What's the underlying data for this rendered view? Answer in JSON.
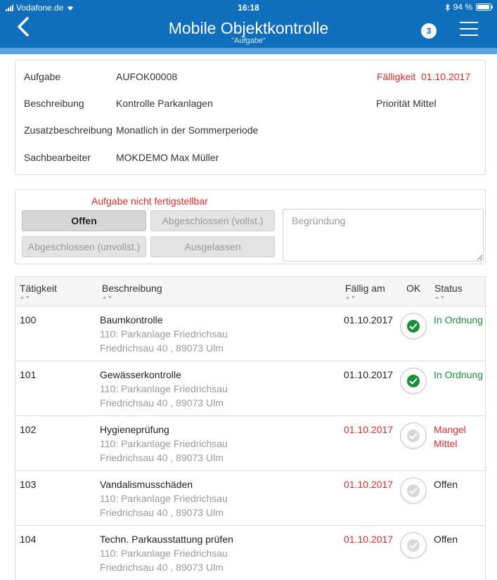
{
  "statusbar": {
    "carrier": "Vodafone.de",
    "time": "16:18",
    "battery": "94 %",
    "battery_level": 0.94
  },
  "header": {
    "title": "Mobile Objektkontrolle",
    "subtitle": "\"Aufgabe\"",
    "badge": "3",
    "back_icon": "chevron-left-icon",
    "menu_icon": "hamburger-menu-icon",
    "color": "#0f6fbd"
  },
  "info": {
    "aufgabe_label": "Aufgabe",
    "aufgabe_value": "AUFOK00008",
    "faelligkeit_label": "Fälligkeit",
    "faelligkeit_value": "01.10.2017",
    "beschreibung_label": "Beschreibung",
    "beschreibung_value": "Kontrolle Parkanlagen",
    "prioritaet_label": "Priorität",
    "prioritaet_value": "Mittel",
    "zusatz_label": "Zusatzbeschreibung",
    "zusatz_value": "Monatlich in der Sommerperiode",
    "sachbearbeiter_label": "Sachbearbeiter",
    "sachbearbeiter_value": "MOKDEMO Max Müller"
  },
  "status_panel": {
    "warning": "Aufgabe nicht fertigstellbar",
    "btn_offen": "Offen",
    "btn_abgeschlossen_vollst": "Abgeschlossen (vollst.)",
    "btn_abgeschlossen_unvollst": "Abgeschlossen (unvollst.)",
    "btn_ausgelassen": "Ausgelassen",
    "selected": "Offen",
    "reason_placeholder": "Begründung"
  },
  "table": {
    "columns": {
      "taetigkeit": "Tätigkeit",
      "beschreibung": "Beschreibung",
      "faellig": "Fällig am",
      "ok": "OK",
      "status": "Status"
    },
    "rows": [
      {
        "id": "100",
        "title": "Baumkontrolle",
        "object": "110: Parkanlage Friedrichsau",
        "address": "Friedrichsau 40 , 89073 Ulm",
        "date": "01.10.2017",
        "date_overdue": false,
        "ok": true,
        "status": "In Ordnung",
        "status_line2": "",
        "status_color": "green"
      },
      {
        "id": "101",
        "title": "Gewässerkontrolle",
        "object": "110: Parkanlage Friedrichsau",
        "address": "Friedrichsau 40 , 89073 Ulm",
        "date": "01.10.2017",
        "date_overdue": false,
        "ok": true,
        "status": "In Ordnung",
        "status_line2": "",
        "status_color": "green"
      },
      {
        "id": "102",
        "title": "Hygieneprüfung",
        "object": "110: Parkanlage Friedrichsau",
        "address": "Friedrichsau 40 , 89073 Ulm",
        "date": "01.10.2017",
        "date_overdue": true,
        "ok": false,
        "status": "Mangel",
        "status_line2": "Mittel",
        "status_color": "red"
      },
      {
        "id": "103",
        "title": "Vandalismusschäden",
        "object": "110: Parkanlage Friedrichsau",
        "address": "Friedrichsau 40 , 89073 Ulm",
        "date": "01.10.2017",
        "date_overdue": true,
        "ok": false,
        "status": "Offen",
        "status_line2": "",
        "status_color": "black"
      },
      {
        "id": "104",
        "title": "Techn. Parkausstattung prüfen",
        "object": "110: Parkanlage Friedrichsau",
        "address": "Friedrichsau 40 , 89073 Ulm",
        "date": "01.10.2017",
        "date_overdue": true,
        "ok": false,
        "status": "Offen",
        "status_line2": "",
        "status_color": "black"
      }
    ]
  }
}
